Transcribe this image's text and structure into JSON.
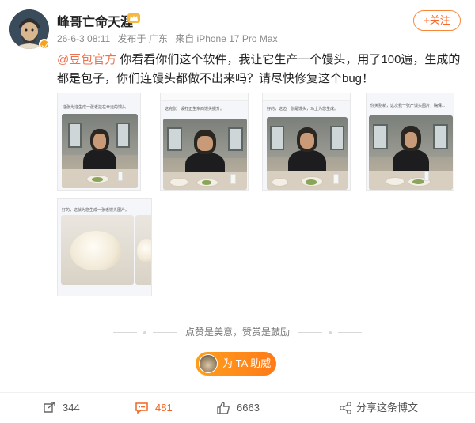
{
  "post": {
    "username": "峰哥亡命天涯",
    "date": "26-6-3 08:11",
    "published_from": "发布于 广东",
    "device": "来自 iPhone 17 Pro Max",
    "follow_label": "+关注",
    "mention": "@豆包官方",
    "text": " 你看看你们这个软件，我让它生产一个馒头，用了100遍，生成的都是包子，你们连馒头都做不出来吗？请尽快修复这个bug！"
  },
  "images": {
    "captions": [
      "这张为这生成一张老拉在幸运的馒头...",
      "这完张一设打正生东西馒头提升。",
      "好的，这边一张是馒头，马上为您生成。",
      "你笑别新，这次我一张产馒头图片，确保..."
    ],
    "bun_caption": "好的，这就为您生成一张老馒头图片。"
  },
  "cheer_text": "点赞是美意，赞赏是鼓励",
  "support_label": "为 TA 助威",
  "actions": {
    "repost_count": "344",
    "comment_count": "481",
    "like_count": "6663",
    "share_label": "分享这条博文"
  },
  "colors": {
    "accent_orange": "#f7682a",
    "mention": "#eb7350",
    "comment_active": "#f0641e"
  },
  "icons": [
    "crown-icon",
    "verified-badge-icon",
    "repost-icon",
    "comment-icon",
    "like-icon",
    "share-icon"
  ]
}
